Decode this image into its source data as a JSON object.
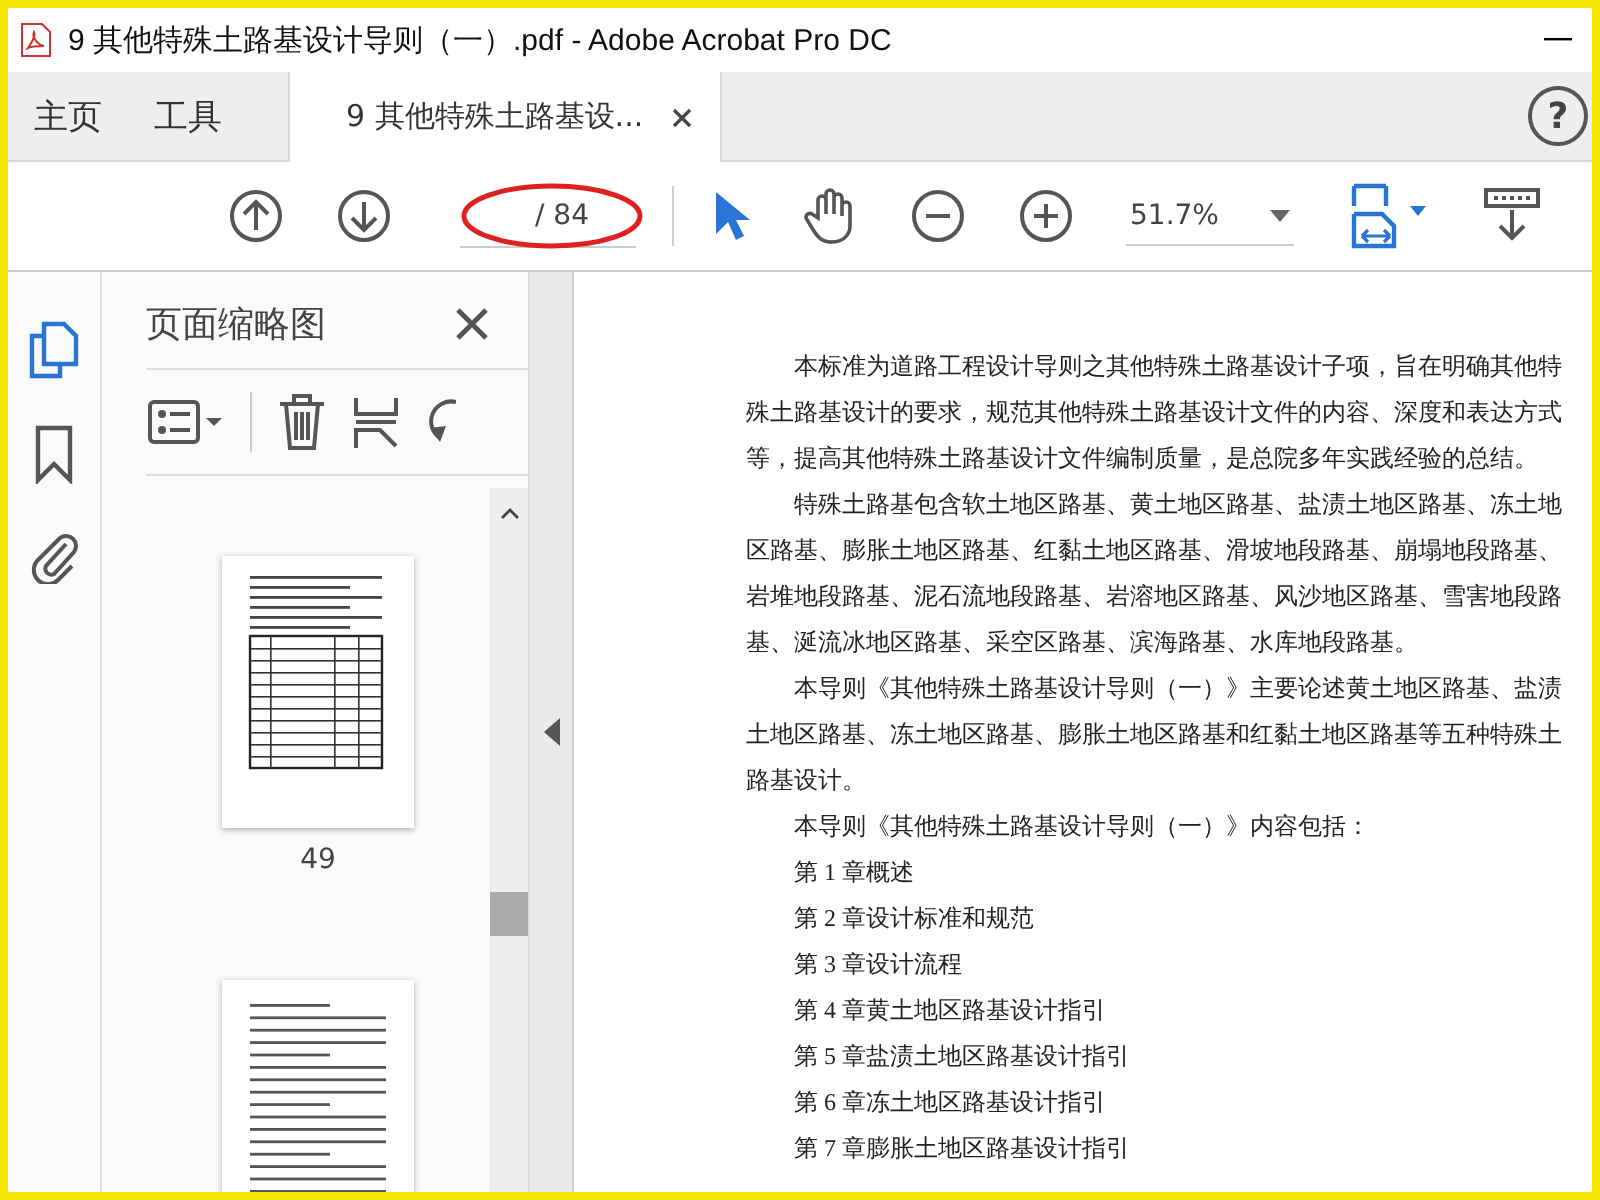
{
  "window": {
    "title": "9 其他特殊土路基设计导则（一）.pdf - Adobe Acrobat Pro DC"
  },
  "tabs": [
    {
      "label": "主页",
      "selected": false
    },
    {
      "label": "工具",
      "selected": false
    },
    {
      "label": "9 其他特殊土路基设...",
      "selected": true
    }
  ],
  "help_label": "?",
  "toolbar": {
    "page_total": "/ 84",
    "zoom": "51.7%"
  },
  "sidebar": {
    "items": [
      {
        "kind": "pages",
        "selected": true
      },
      {
        "kind": "bookmark",
        "selected": false
      },
      {
        "kind": "attachment",
        "selected": false
      }
    ]
  },
  "thumbnails_panel": {
    "title": "页面缩略图",
    "pages": [
      {
        "label": "49",
        "kind": "table"
      },
      {
        "kind": "text"
      }
    ]
  },
  "document": {
    "paragraphs": [
      "本标准为道路工程设计导则之其他特殊土路基设计子项，旨在明确其他特殊土路基设计的要求，规范其他特殊土路基设计文件的内容、深度和表达方式等，提高其他特殊土路基设计文件编制质量，是总院多年实践经验的总结。",
      "特殊土路基包含软土地区路基、黄土地区路基、盐渍土地区路基、冻土地区路基、膨胀土地区路基、红黏土地区路基、滑坡地段路基、崩塌地段路基、岩堆地段路基、泥石流地段路基、岩溶地区路基、风沙地区路基、雪害地段路基、涎流冰地区路基、采空区路基、滨海路基、水库地段路基。",
      "本导则《其他特殊土路基设计导则（一）》主要论述黄土地区路基、盐渍土地区路基、冻土地区路基、膨胀土地区路基和红黏土地区路基等五种特殊土路基设计。",
      "本导则《其他特殊土路基设计导则（一）》内容包括：",
      "第 1 章概述",
      "第 2 章设计标准和规范",
      "第 3 章设计流程",
      "第 4 章黄土地区路基设计指引",
      "第 5 章盐渍土地区路基设计指引",
      "第 6 章冻土地区路基设计指引",
      "第 7 章膨胀土地区路基设计指引"
    ]
  }
}
